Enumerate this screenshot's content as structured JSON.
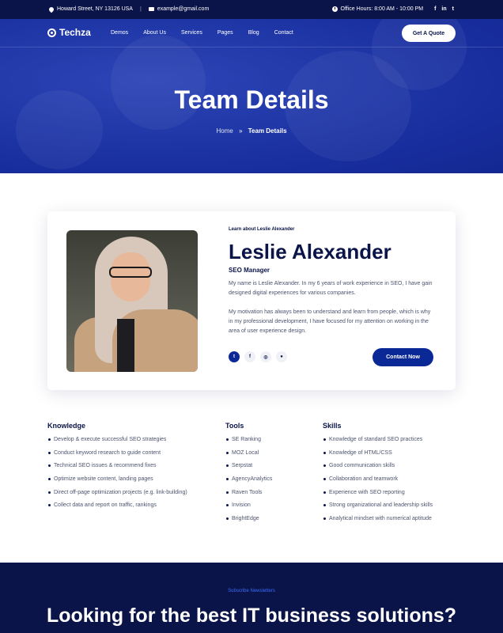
{
  "topbar": {
    "address": "Howard Street, NY 13126 USA",
    "email": "example@gmail.com",
    "hours": "Office Hours: 8:00 AM - 10:00 PM",
    "social": [
      "f",
      "in",
      "t"
    ]
  },
  "nav": {
    "brand": "Techza",
    "items": [
      "Demos",
      "About Us",
      "Services",
      "Pages",
      "Blog",
      "Contact"
    ],
    "cta": "Get A Quote"
  },
  "hero": {
    "title": "Team Details",
    "breadcrumb": {
      "home": "Home",
      "separator": "»",
      "current": "Team Details"
    }
  },
  "profile": {
    "eyebrow": "Learn about Leslie Alexander",
    "name": "Leslie Alexander",
    "role": "SEO Manager",
    "bio1": "My name is Leslie Alexander. In my 6 years of work experience in SEO, I have gain designed digital experiences for various companies.",
    "bio2": "My motivation has always been to understand and learn from people, which is why in my professional development, I have focused for  my attention on working in the area of user experience design.",
    "socials": [
      "twitter-icon",
      "facebook-icon",
      "instagram-icon",
      "github-icon"
    ],
    "contact_label": "Contact Now"
  },
  "knowledge": {
    "title": "Knowledge",
    "items": [
      "Develop & execute successful SEO strategies",
      "Conduct keyword research to guide content",
      "Technical SEO issues & recommend fixes",
      "Optimize website content, landing pages",
      "Direct off-page optimization projects (e.g. link-building)",
      "Collect data and report on traffic, rankings"
    ]
  },
  "tools": {
    "title": "Tools",
    "items": [
      "SE Ranking",
      "MOZ Local",
      "Serpstat",
      "AgencyAnalytics",
      "Raven Tools",
      "Invision",
      "BrightEdge"
    ]
  },
  "skills": {
    "title": "Skills",
    "items": [
      "Knowledge of standard SEO practices",
      "Knowledge of HTML/CSS",
      "Good communication skills",
      "Collaboration and teamwork",
      "Experience with SEO reporting",
      "Strong organizational and leadership skills",
      "Analytical mindset with numerical aptitude"
    ]
  },
  "newsletter": {
    "label": "Subscribe Newsletters",
    "title": "Looking for the best IT business solutions?"
  },
  "colors": {
    "navy": "#0a1448",
    "primary": "#0a2896",
    "hero": "#2a43b6",
    "accent": "#3d6bff"
  }
}
